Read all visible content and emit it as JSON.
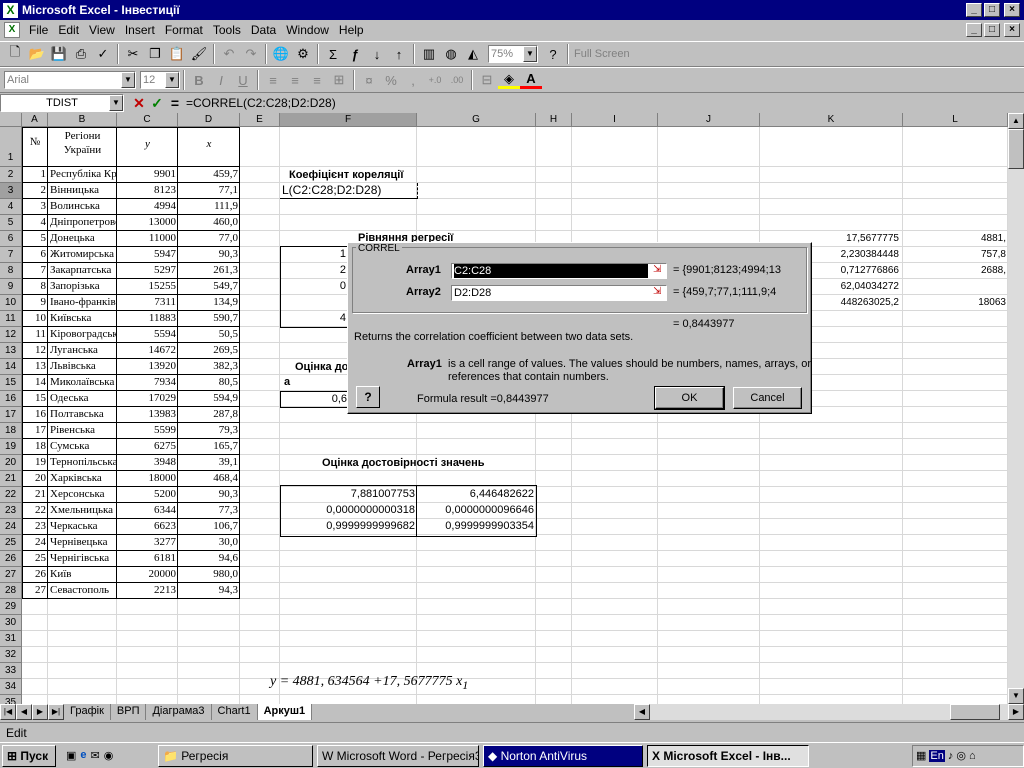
{
  "window": {
    "title": "Microsoft Excel - Інвестиції",
    "logo": "X"
  },
  "menu": [
    "File",
    "Edit",
    "View",
    "Insert",
    "Format",
    "Tools",
    "Data",
    "Window",
    "Help"
  ],
  "toolbar": {
    "zoom": "75%",
    "full_screen": "Full Screen"
  },
  "format_toolbar": {
    "font": "Arial",
    "size": "12",
    "bold": "B",
    "italic": "I",
    "underline": "U",
    "percent": "%",
    "comma": ",",
    "inc_dec": "+.0",
    "dec_dec": ".00",
    "font_color_glyph": "A"
  },
  "formula_bar": {
    "name_box": "TDIST",
    "formula": "=CORREL(C2:C28;D2:D28)",
    "cancel": "✕",
    "enter": "✓",
    "equals": "="
  },
  "columns": [
    "A",
    "B",
    "C",
    "D",
    "E",
    "F",
    "G",
    "H",
    "I",
    "J",
    "K",
    "L"
  ],
  "header_row": {
    "a": "№",
    "b": "Регіони України",
    "c": "y",
    "d": "x"
  },
  "table": [
    [
      "1",
      "Республіка Крим",
      "9901",
      "459,7"
    ],
    [
      "2",
      "Вінницька",
      "8123",
      "77,1"
    ],
    [
      "3",
      "Волинська",
      "4994",
      "111,9"
    ],
    [
      "4",
      "Дніпропетровська",
      "13000",
      "460,0"
    ],
    [
      "5",
      "Донецька",
      "11000",
      "77,0"
    ],
    [
      "6",
      "Житомирська",
      "5947",
      "90,3"
    ],
    [
      "7",
      "Закарпатська",
      "5297",
      "261,3"
    ],
    [
      "8",
      "Запорізька",
      "15255",
      "549,7"
    ],
    [
      "9",
      "Івано-франківська",
      "7311",
      "134,9"
    ],
    [
      "10",
      "Київська",
      "11883",
      "590,7"
    ],
    [
      "11",
      "Кіровоградська",
      "5594",
      "50,5"
    ],
    [
      "12",
      "Луганська",
      "14672",
      "269,5"
    ],
    [
      "13",
      "Львівська",
      "13920",
      "382,3"
    ],
    [
      "14",
      "Миколаївська",
      "7934",
      "80,5"
    ],
    [
      "15",
      "Одеська",
      "17029",
      "594,9"
    ],
    [
      "16",
      "Полтавська",
      "13983",
      "287,8"
    ],
    [
      "17",
      "Рівенська",
      "5599",
      "79,3"
    ],
    [
      "18",
      "Сумська",
      "6275",
      "165,7"
    ],
    [
      "19",
      "Тернопільська",
      "3948",
      "39,1"
    ],
    [
      "20",
      "Харківська",
      "18000",
      "468,4"
    ],
    [
      "21",
      "Херсонська",
      "5200",
      "90,3"
    ],
    [
      "22",
      "Хмельницька",
      "6344",
      "77,3"
    ],
    [
      "23",
      "Черкаська",
      "6623",
      "106,7"
    ],
    [
      "24",
      "Чернівецька",
      "3277",
      "30,0"
    ],
    [
      "25",
      "Чернігівська",
      "6181",
      "94,6"
    ],
    [
      "26",
      "Київ",
      "20000",
      "980,0"
    ],
    [
      "27",
      "Севастополь",
      "2213",
      "94,3"
    ]
  ],
  "labels": {
    "correlation": "Коефіцієнт кореляції",
    "correlation_edit": "L(C2:C28;D2:D28)",
    "regression": "Рівняння регресії",
    "estimate_params": "Оцінка до",
    "param_a": "а",
    "param_val": "0,6",
    "reliability": "Оцінка достовірності значень",
    "reg_left": [
      "1",
      "2",
      "0",
      "",
      "4"
    ]
  },
  "k_values": [
    "17,5677775",
    "2,230384448",
    "0,712776866",
    "62,04034272",
    "448263025,2"
  ],
  "l_values": [
    "4881,",
    "757,8",
    "2688,",
    "",
    "18063"
  ],
  "reliability_table": [
    [
      "7,881007753",
      "6,446482622"
    ],
    [
      "0,0000000000318",
      "0,0000000096646"
    ],
    [
      "0,9999999999682",
      "0,9999999903354"
    ]
  ],
  "equation": "y = 4881, 634564 +17, 5677775 x",
  "equation_sub": "1",
  "dialog": {
    "title": "CORREL",
    "array1_label": "Array1",
    "array1_value": "C2:C28",
    "array1_result": "= {9901;8123;4994;13",
    "array2_label": "Array2",
    "array2_value": "D2:D28",
    "array2_result": "= {459,7;77,1;111,9;4",
    "result": "= 0,8443977",
    "description": "Returns the correlation coefficient between two data sets.",
    "help_bold": "Array1",
    "help_text": "is a cell range of values. The values should be numbers, names, arrays, or",
    "help_text2": "references that contain numbers.",
    "formula_result": "Formula result =0,8443977",
    "ok": "OK",
    "cancel": "Cancel",
    "help_glyph": "?"
  },
  "sheet_tabs": [
    "Графік",
    "ВРП",
    "Діаграма3",
    "Chart1",
    "Аркуш1"
  ],
  "status": "Edit",
  "taskbar": {
    "start": "Пуск",
    "tasks": [
      "Регресія",
      "Microsoft Word - Регресія3",
      "Norton AntiVirus",
      "Microsoft Excel - Інв..."
    ],
    "tray": "En"
  }
}
